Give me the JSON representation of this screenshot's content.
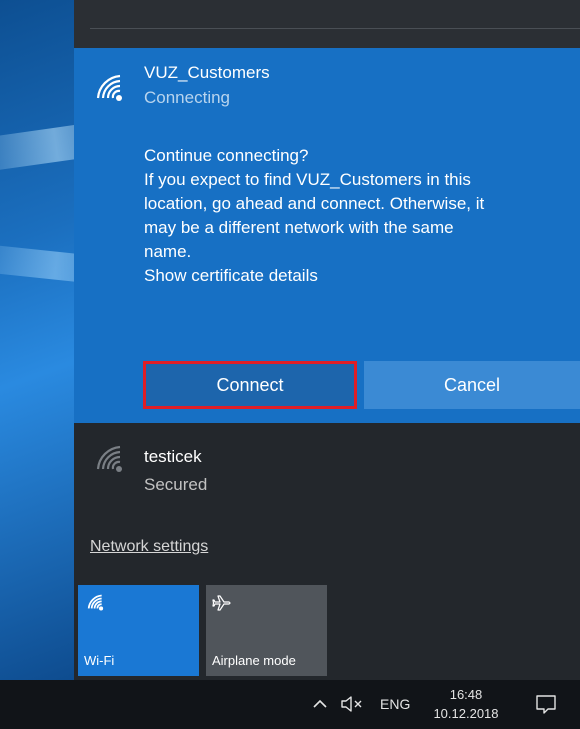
{
  "active_network": {
    "name": "VUZ_Customers",
    "status": "Connecting",
    "prompt_lines": [
      "Continue connecting?",
      "If you expect to find VUZ_Customers in this",
      "location, go ahead and connect. Otherwise, it",
      "may be a different network with the same",
      "name.",
      "Show certificate details"
    ],
    "connect_label": "Connect",
    "cancel_label": "Cancel",
    "icon": "wifi-icon"
  },
  "other_network": {
    "name": "testicek",
    "status": "Secured",
    "icon": "wifi-icon"
  },
  "network_settings_label": "Network settings",
  "quick_actions": [
    {
      "label": "Wi-Fi",
      "icon": "wifi-icon",
      "active": true
    },
    {
      "label": "Airplane mode",
      "icon": "airplane-icon",
      "active": false
    }
  ],
  "taskbar": {
    "language": "ENG",
    "time": "16:48",
    "date": "10.12.2018",
    "volume_icon": "speaker-muted-icon",
    "tray_icon": "chevron-up-icon",
    "notification_icon": "action-center-icon"
  },
  "colors": {
    "accent": "#1770c4",
    "highlight_border": "#e01e26",
    "flyout_bg": "#23272c"
  }
}
